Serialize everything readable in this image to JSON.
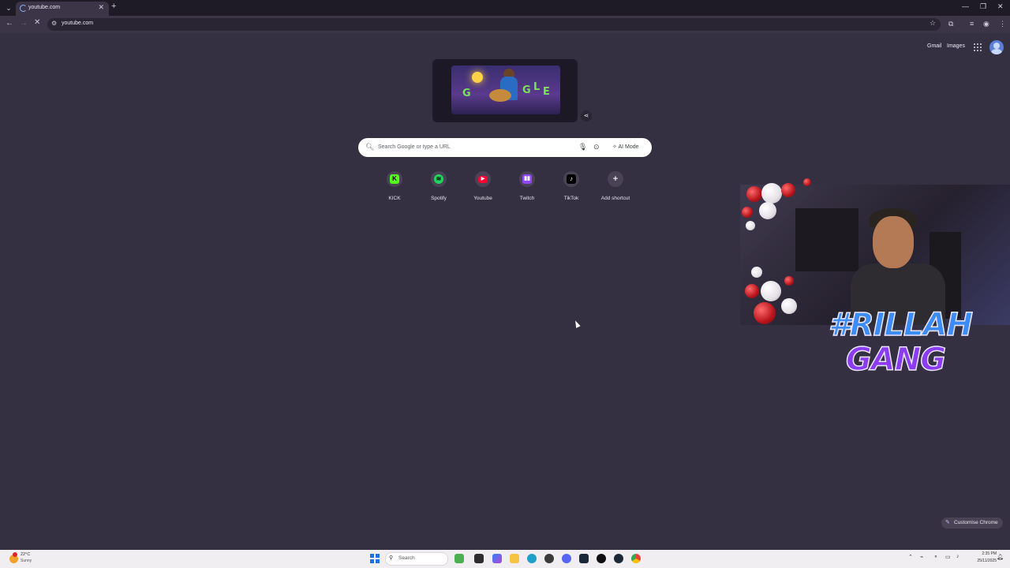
{
  "browser": {
    "tab": {
      "title": "youtube.com"
    },
    "address": "youtube.com"
  },
  "header_links": {
    "gmail": "Gmail",
    "images": "Images"
  },
  "search": {
    "placeholder": "Search Google or type a URL",
    "ai_mode_label": "AI Mode"
  },
  "shortcuts": [
    {
      "label": "KICK",
      "icon": "kick-icon",
      "color": "#53fc18"
    },
    {
      "label": "Spotify",
      "icon": "spotify-icon",
      "color": "#1ed760"
    },
    {
      "label": "Youtube",
      "icon": "youtube-icon",
      "color": "#ff0033"
    },
    {
      "label": "Twitch",
      "icon": "twitch-icon",
      "color": "#9146ff"
    },
    {
      "label": "TikTok",
      "icon": "tiktok-icon",
      "color": "#000000"
    },
    {
      "label": "Add shortcut",
      "icon": "plus-icon",
      "color": "#c9b8ff"
    }
  ],
  "overlay": {
    "line1": "#RILLAH",
    "line2": "GANG"
  },
  "customise_label": "Customise Chrome",
  "taskbar": {
    "weather_temp": "22°C",
    "weather_condition": "Sunny",
    "search_label": "Search",
    "time": "2:35 PM",
    "date": "25/11/2025"
  },
  "colors": {
    "page_background": "#352f42",
    "accent": "#8ab4f8"
  }
}
